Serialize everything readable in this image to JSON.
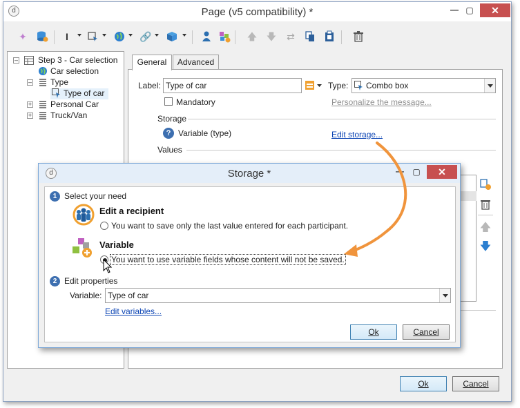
{
  "main_window": {
    "title": "Page (v5 compatibility) *",
    "close_label": "✕"
  },
  "toolbar": {
    "icons": [
      "wand-icon",
      "database-icon",
      "text-cursor-icon",
      "select-icon",
      "globe-icon",
      "link-icon",
      "cube-icon",
      "person-icon",
      "group-add-icon",
      "arrow-up-icon",
      "arrow-down-icon",
      "shuffle-icon",
      "copy-icon",
      "paste-icon",
      "delete-icon"
    ]
  },
  "tree": {
    "items": [
      {
        "label": "Step 3 - Car selection"
      },
      {
        "label": "Car selection"
      },
      {
        "label": "Type"
      },
      {
        "label": "Type of car"
      },
      {
        "label": "Personal Car"
      },
      {
        "label": "Truck/Van"
      }
    ]
  },
  "tabs": [
    {
      "label": "General"
    },
    {
      "label": "Advanced"
    }
  ],
  "general": {
    "label_caption": "Label:",
    "label_value": "Type of car",
    "type_caption": "Type:",
    "type_value": "Combo box",
    "mandatory_label": "Mandatory",
    "personalize_link": "Personalize the message...",
    "storage_section": "Storage",
    "storage_variable": "Variable (type)",
    "edit_storage_link": "Edit storage...",
    "values_section": "Values"
  },
  "main_buttons": {
    "ok": "Ok",
    "cancel": "Cancel"
  },
  "storage_dialog": {
    "title": "Storage *",
    "step1_number": "1",
    "step1_label": "Select your need",
    "option_recipient_title": "Edit a recipient",
    "option_recipient_text": "You want to save only the last value entered for each participant.",
    "option_variable_title": "Variable",
    "option_variable_text": "You want to use variable fields whose content will not be saved.",
    "selected_option": "variable",
    "step2_number": "2",
    "step2_label": "Edit properties",
    "variable_caption": "Variable:",
    "variable_value": "Type of car",
    "edit_variables_link": "Edit variables...",
    "ok": "Ok",
    "cancel": "Cancel",
    "close_label": "✕"
  },
  "colors": {
    "accent_link": "#0b44b4",
    "close_red": "#c75050",
    "arrow_orange": "#f0943c",
    "step_blue": "#3d6fb0"
  }
}
